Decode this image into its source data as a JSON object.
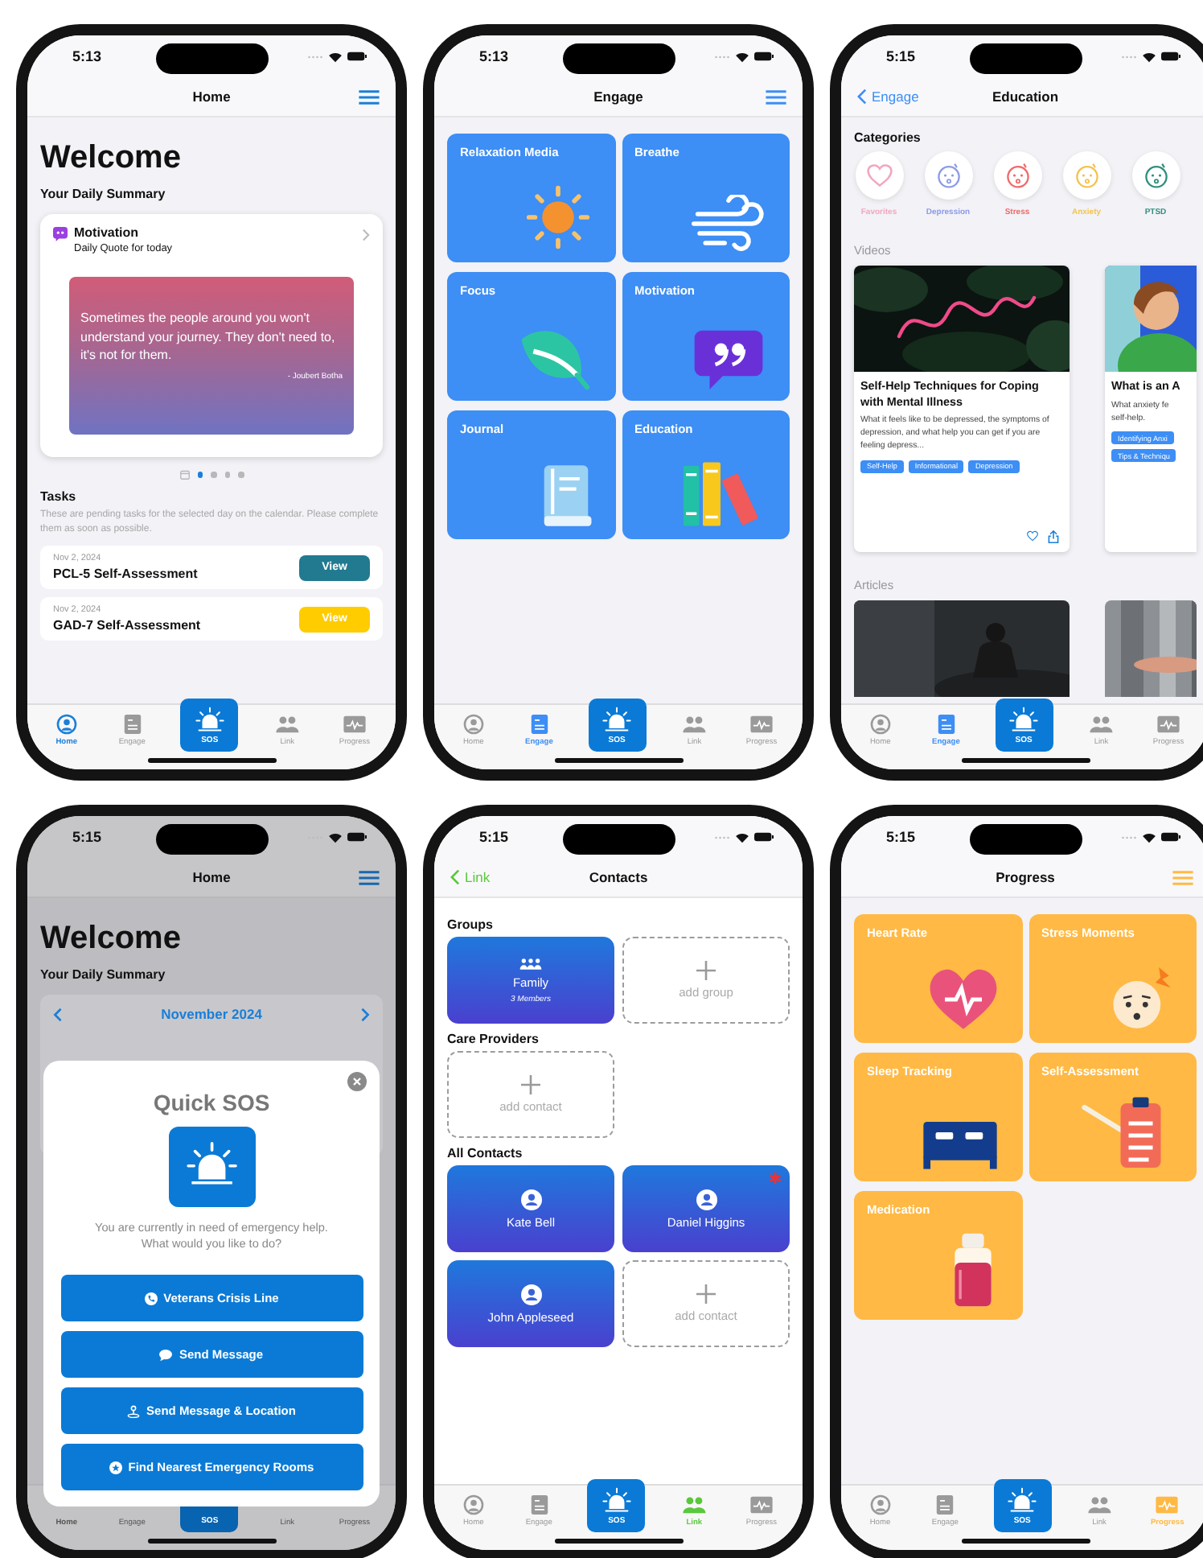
{
  "phones": [
    {
      "kind": "home",
      "time": "5:13",
      "color": "#1a7fd8",
      "nav": {
        "title": "Home",
        "menu": true
      },
      "heading": "Welcome",
      "subheading": "Your Daily Summary",
      "quote_card": {
        "title": "Motivation",
        "subtitle": "Daily Quote for today",
        "quote": "Sometimes the people around you won't understand your journey. They don't need to, it's not for them.",
        "author": "- Joubert Botha"
      },
      "pages": [
        {
          "kind": "calendar",
          "selected": false
        },
        {
          "kind": "dot",
          "selected": true
        },
        {
          "kind": "dot",
          "selected": false
        },
        {
          "kind": "dot",
          "selected": false
        },
        {
          "kind": "dot",
          "selected": false
        }
      ],
      "tasks_heading": "Tasks",
      "tasks_note": "These are pending tasks for the selected day on the calendar. Please complete them as soon as possible.",
      "tasks": [
        {
          "date": "Nov 2, 2024",
          "name": "PCL-5 Self-Assessment",
          "action": "View",
          "color": "#217a8f"
        },
        {
          "date": "Nov 2, 2024",
          "name": "GAD-7 Self-Assessment",
          "action": "View",
          "color": "#ffcc00"
        }
      ],
      "tabs": [
        {
          "label": "Home",
          "kind": "home",
          "selected": true
        },
        {
          "label": "Engage",
          "kind": "engage",
          "selected": false
        },
        {
          "label": "SOS",
          "kind": "sos",
          "selected": false
        },
        {
          "label": "Link",
          "kind": "link",
          "selected": false
        },
        {
          "label": "Progress",
          "kind": "progress",
          "selected": false
        }
      ]
    },
    {
      "kind": "tiles",
      "time": "5:13",
      "color": "#3d8ef5",
      "nav": {
        "title": "Engage",
        "menu": true
      },
      "tiles": [
        {
          "label": "Relaxation Media",
          "kind": "sun"
        },
        {
          "label": "Breathe",
          "kind": "wind"
        },
        {
          "label": "Focus",
          "kind": "leaf"
        },
        {
          "label": "Motivation",
          "kind": "quote"
        },
        {
          "label": "Journal",
          "kind": "book"
        },
        {
          "label": "Education",
          "kind": "books"
        }
      ],
      "tabs": [
        {
          "label": "Home",
          "kind": "home",
          "selected": false
        },
        {
          "label": "Engage",
          "kind": "engage",
          "selected": true
        },
        {
          "label": "SOS",
          "kind": "sos",
          "selected": false
        },
        {
          "label": "Link",
          "kind": "link",
          "selected": false
        },
        {
          "label": "Progress",
          "kind": "progress",
          "selected": false
        }
      ]
    },
    {
      "kind": "education",
      "time": "5:15",
      "color": "#3d8ef5",
      "nav": {
        "title": "Education",
        "back": "Engage"
      },
      "categories_heading": "Categories",
      "categories": [
        {
          "label": "Favorites",
          "kind": "heart",
          "color": "#f2a7be"
        },
        {
          "label": "Depression",
          "kind": "face",
          "color": "#8c9be6"
        },
        {
          "label": "Stress",
          "kind": "face",
          "color": "#ef6a6a"
        },
        {
          "label": "Anxiety",
          "kind": "face",
          "color": "#f3c34d"
        },
        {
          "label": "PTSD",
          "kind": "face",
          "color": "#2f8f7f"
        }
      ],
      "videos_heading": "Videos",
      "videos": [
        {
          "title": "Self-Help Techniques for Coping with Mental Illness",
          "description": "What it feels like to be depressed, the symptoms of depression, and what help you can get if you are feeling depress...",
          "tags": [
            "Self-Help",
            "Informational",
            "Depression"
          ],
          "actions": true
        },
        {
          "title": "What is an A",
          "description": "What anxiety fe\nself-help.",
          "tags": [
            "Identifying Anxi",
            "Tips & Techniqu"
          ]
        }
      ],
      "articles_heading": "Articles",
      "articles": [
        {
          "kind": "picture"
        },
        {
          "kind": "picture"
        }
      ],
      "tabs": [
        {
          "label": "Home",
          "kind": "home",
          "selected": false
        },
        {
          "label": "Engage",
          "kind": "engage",
          "selected": true
        },
        {
          "label": "SOS",
          "kind": "sos",
          "selected": false
        },
        {
          "label": "Link",
          "kind": "link",
          "selected": false
        },
        {
          "label": "Progress",
          "kind": "progress",
          "selected": false
        }
      ]
    },
    {
      "kind": "home",
      "time": "5:15",
      "color": "#1767b0",
      "nav": {
        "title": "Home",
        "menu": true
      },
      "heading": "Welcome",
      "subheading": "Your Daily Summary",
      "calendar": {
        "month": "November 2024"
      },
      "sos_dialog": {
        "title": "Quick SOS",
        "message": "You are currently in need of emergency help. What would you like to do?",
        "actions": [
          {
            "label": "Veterans Crisis Line",
            "kind": "phone"
          },
          {
            "label": "Send Message",
            "kind": "message"
          },
          {
            "label": "Send Message & Location",
            "kind": "location"
          },
          {
            "label": "Find Nearest Emergency Rooms",
            "kind": "star"
          }
        ]
      },
      "tabs": [
        {
          "label": "Home",
          "kind": "home",
          "selected": true
        },
        {
          "label": "Engage",
          "kind": "engage",
          "selected": false
        },
        {
          "label": "SOS",
          "kind": "sos",
          "selected": false
        },
        {
          "label": "Link",
          "kind": "link",
          "selected": false
        },
        {
          "label": "Progress",
          "kind": "progress",
          "selected": false
        }
      ]
    },
    {
      "kind": "contacts",
      "time": "5:15",
      "color": "#5ac83c",
      "nav": {
        "title": "Contacts",
        "back": "Link"
      },
      "sections": [
        {
          "heading": "Groups",
          "items": [
            {
              "kind": "group",
              "name": "Family",
              "note": "3 Members"
            },
            {
              "kind": "add",
              "name": "add group"
            }
          ]
        },
        {
          "heading": "Care Providers",
          "items": [
            {
              "kind": "add",
              "name": "add contact"
            }
          ]
        },
        {
          "heading": "All Contacts",
          "items": [
            {
              "kind": "contact",
              "name": "Kate Bell",
              "flagged": false
            },
            {
              "kind": "contact",
              "name": "Daniel Higgins",
              "flagged": true
            },
            {
              "kind": "contact",
              "name": "John Appleseed",
              "flagged": false
            },
            {
              "kind": "add",
              "name": "add contact"
            }
          ]
        }
      ],
      "tabs": [
        {
          "label": "Home",
          "kind": "home",
          "selected": false
        },
        {
          "label": "Engage",
          "kind": "engage",
          "selected": false
        },
        {
          "label": "SOS",
          "kind": "sos",
          "selected": false
        },
        {
          "label": "Link",
          "kind": "link",
          "selected": true
        },
        {
          "label": "Progress",
          "kind": "progress",
          "selected": false
        }
      ]
    },
    {
      "kind": "tiles",
      "time": "5:15",
      "color": "#ffb944",
      "nav": {
        "title": "Progress",
        "menu": true
      },
      "tiles": [
        {
          "label": "Heart Rate",
          "kind": "heart"
        },
        {
          "label": "Stress Moments",
          "kind": "stress"
        },
        {
          "label": "Sleep Tracking",
          "kind": "bed"
        },
        {
          "label": "Self-Assessment",
          "kind": "clipboard"
        },
        {
          "label": "Medication",
          "kind": "bottle"
        }
      ],
      "tabs": [
        {
          "label": "Home",
          "kind": "home",
          "selected": false
        },
        {
          "label": "Engage",
          "kind": "engage",
          "selected": false
        },
        {
          "label": "SOS",
          "kind": "sos",
          "selected": false
        },
        {
          "label": "Link",
          "kind": "link",
          "selected": false
        },
        {
          "label": "Progress",
          "kind": "progress",
          "selected": true
        }
      ]
    }
  ]
}
